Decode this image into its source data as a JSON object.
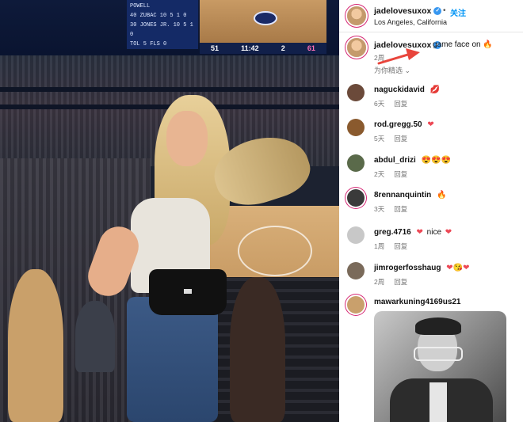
{
  "header": {
    "username": "jadelovesuxox",
    "separator": "•",
    "follow_label": "关注",
    "location": "Los Angeles, California"
  },
  "caption": {
    "username": "jadelovesuxox",
    "text": "game face on",
    "emoji": "🔥",
    "time": "2周"
  },
  "translate_label": "为你精选",
  "scoreboard": {
    "stats_lines": [
      "POWELL",
      "40 ZUBAC 10 5 1 0",
      "30 JONES JR. 10 5 1 0",
      "TOL 5  FLS 0"
    ],
    "home_score": "51",
    "clock": "11:42",
    "period": "2",
    "away_score": "61"
  },
  "comments": [
    {
      "username": "naguckidavid",
      "text": "",
      "emoji": "💋",
      "time": "6天",
      "reply": "回复",
      "avatar_color": "#6b4a3a"
    },
    {
      "username": "rod.gregg.50",
      "text": "",
      "emoji": "❤",
      "time": "5天",
      "reply": "回复",
      "avatar_color": "#8a5a2e"
    },
    {
      "username": "abdul_drizi",
      "text": "",
      "emoji": "😍😍😍",
      "time": "2天",
      "reply": "回复",
      "avatar_color": "#5a6a4a"
    },
    {
      "username": "8rennanquintin",
      "text": "",
      "emoji": "🔥",
      "time": "3天",
      "reply": "回复",
      "avatar_color": "#3a3a3a"
    },
    {
      "username": "greg.4716",
      "text": "nice",
      "emoji": "❤",
      "emoji_after": "❤",
      "time": "1周",
      "reply": "回复",
      "avatar_color": "#c8c8c8"
    },
    {
      "username": "jimrogerfosshaug",
      "text": "",
      "emoji": "❤😘❤",
      "time": "2周",
      "reply": "回复",
      "avatar_color": "#7a6a5a"
    },
    {
      "username": "mawarkuning4169us21",
      "text": "",
      "emoji": "",
      "time": "",
      "reply": "",
      "avatar_color": "#c9a06c"
    }
  ]
}
